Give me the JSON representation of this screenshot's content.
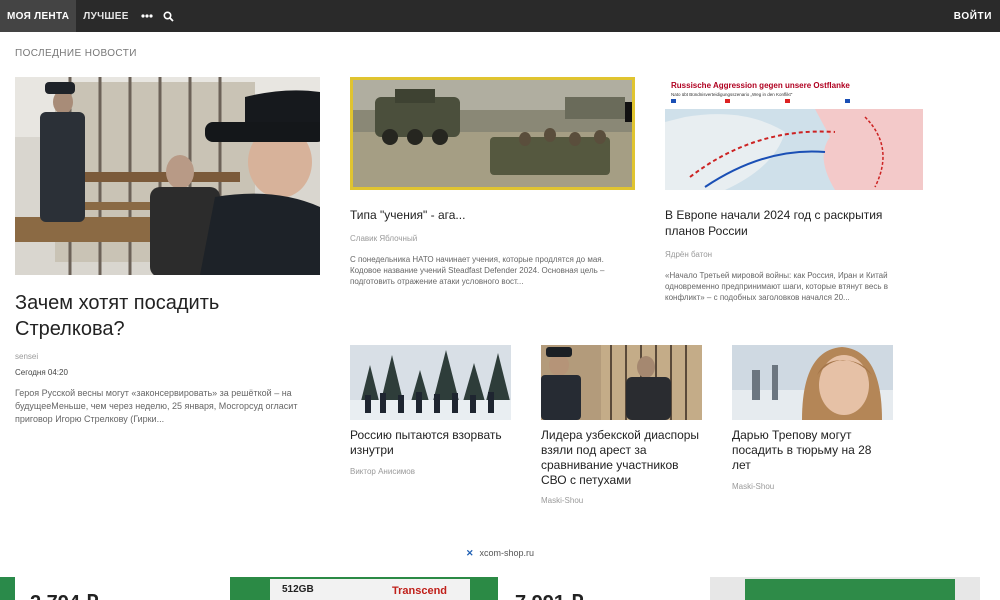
{
  "nav": {
    "items": [
      "МОЯ ЛЕНТА",
      "ЛУЧШЕЕ"
    ],
    "more_icon": "more-dots-icon",
    "search_icon": "search-icon",
    "login": "ВОЙТИ"
  },
  "section_title": "ПОСЛЕДНИЕ НОВОСТИ",
  "featured": {
    "title": "Зачем хотят посадить Стрелкова?",
    "author": "sensei",
    "date": "Сегодня 04:20",
    "excerpt": "Героя Русской весны могут «законсервировать» за решёткой – на будущееМеньше, чем через неделю, 25 января, Мосгорсуд огласит приговор Игорю Стрелкову (Гирки..."
  },
  "top_articles": [
    {
      "title": "Типа \"учения\" - ага...",
      "author": "Славик Яблочный",
      "excerpt": "С понедельника НАТО начинает учения, которые продлятся до мая. Кодовое название учений Steadfast Defender 2024. Основная цель – подготовить отражение атаки условного вост..."
    },
    {
      "title": "В Европе начали 2024 год с раскрытия планов России",
      "author": "Ядрён батон",
      "excerpt": "«Начало Третьей мировой войны: как Россия, Иран и Китай одновременно предпринимают шаги, которые втянут весь в конфликт» – с подобных заголовков начался 20...",
      "map_heading": "Russische Aggression gegen unsere Ostflanke",
      "map_subheading": "Nato übt Bündnisverteidigungsszenario „Weg in den Konflikt\""
    }
  ],
  "small_articles": [
    {
      "title": "Россию пытаются взорвать изнутри",
      "author": "Виктор Анисимов"
    },
    {
      "title": "Лидера узбекской диаспоры взяли под арест за сравнивание участников СВО с петухами",
      "author": "Maski-Shou"
    },
    {
      "title": "Дарью Трепову могут посадить в тюрьму на 28 лет",
      "author": "Maski-Shou"
    }
  ],
  "ad": {
    "source": "xcom-shop.ru"
  },
  "bottom_ads": {
    "left_text": "2 794 ₽",
    "product_text": "512GB",
    "brand": "Transcend",
    "right_text": "7 991 ₽"
  },
  "colors": {
    "topbar": "#2a2a2a",
    "accent_blue": "#1e5fb3"
  }
}
